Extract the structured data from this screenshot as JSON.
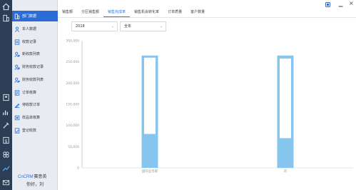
{
  "rail": {
    "icons": [
      "home-icon",
      "building-icon",
      "contacts-icon",
      "chart-icon",
      "tools-icon",
      "money-icon",
      "document-icon",
      "grid-icon",
      "trend-icon",
      "mail-icon"
    ]
  },
  "sidebar": {
    "items": [
      {
        "label": "部门数据",
        "icon": "building-icon",
        "active": true
      },
      {
        "label": "本人数据",
        "icon": "person-icon",
        "active": false
      },
      {
        "label": "收款记录",
        "icon": "receipt-icon",
        "active": false
      },
      {
        "label": "新收款列表",
        "icon": "user-money-icon",
        "active": false
      },
      {
        "label": "财务收款记录",
        "icon": "finance-record-icon",
        "active": false
      },
      {
        "label": "财务收款列表",
        "icon": "user-money-icon",
        "active": false
      },
      {
        "label": "订单核算",
        "icon": "order-icon",
        "active": false
      },
      {
        "label": "待收款订单",
        "icon": "pen-icon",
        "active": false
      },
      {
        "label": "样品单核算",
        "icon": "sample-icon",
        "active": false
      },
      {
        "label": "登记收款",
        "icon": "register-icon",
        "active": false
      }
    ],
    "brand": "CnCRM",
    "brand_cn": "赛意英",
    "greeting": "你好，刘"
  },
  "tabs": [
    "销售额",
    "分区销售额",
    "销售完成率",
    "销售机会转化率",
    "订单质量",
    "客户数量"
  ],
  "active_tab": 2,
  "filters": {
    "year": "2018",
    "period": "全年"
  },
  "chart_data": {
    "type": "bar",
    "title": "",
    "xlabel": "",
    "ylabel": "",
    "ylim": [
      0,
      300000
    ],
    "yticks": [
      "300,000",
      "250,000",
      "200,000",
      "150,000",
      "100,000",
      "50,000",
      "0"
    ],
    "categories": [
      "国际业务部",
      "刘"
    ],
    "series": [
      {
        "name": "",
        "values": [
          265000,
          265000
        ],
        "color": "#86c5ee"
      },
      {
        "name": "",
        "values": [
          260000,
          258000
        ],
        "color": "#ffffff",
        "base": [
          80000,
          70000
        ]
      }
    ],
    "grid": false,
    "legend": "none"
  },
  "window": {
    "close": "×"
  }
}
